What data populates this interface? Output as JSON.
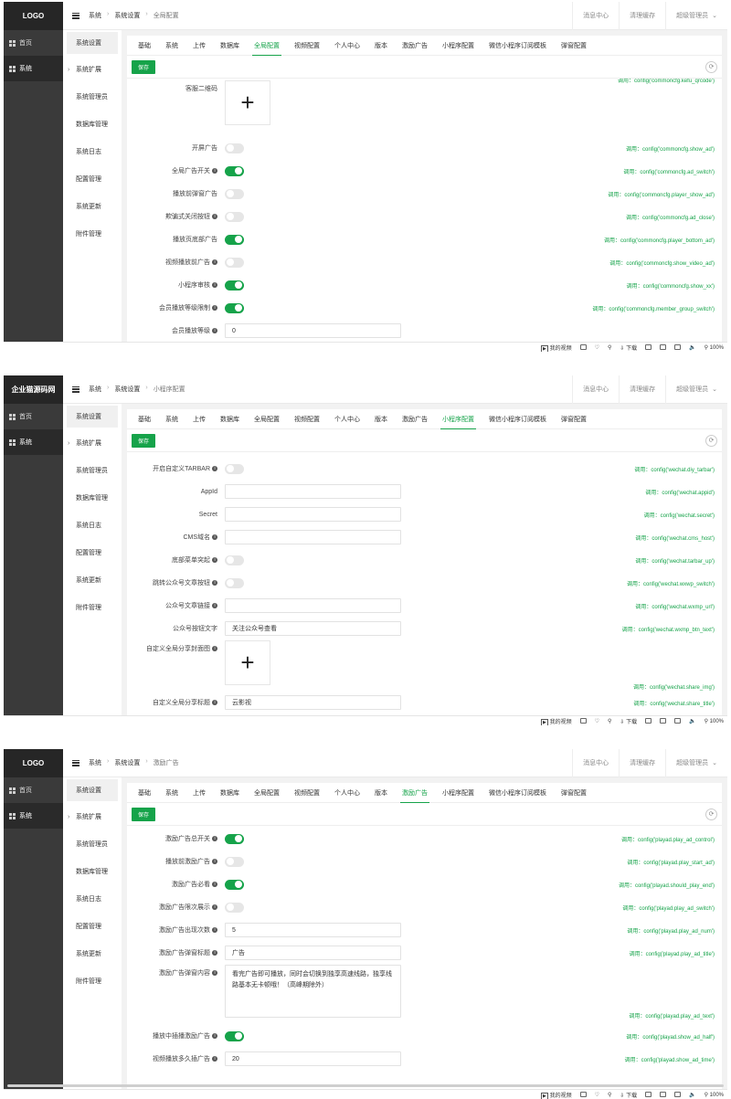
{
  "common": {
    "logo_a": "LOGO",
    "logo_b": "企业猫源码网",
    "menu_home": "首页",
    "menu_system": "系统",
    "crumb_1": "系统",
    "crumb_2": "系统设置",
    "top_msg": "消息中心",
    "top_cache": "清理缓存",
    "top_user": "超级管理员",
    "save": "保存",
    "call_prefix": "调用：",
    "sub_menu": [
      "系统设置",
      "系统扩展",
      "系统管理员",
      "数据库管理",
      "系统日志",
      "配置管理",
      "系统更新",
      "附件管理"
    ],
    "tabs": [
      "基础",
      "系统",
      "上传",
      "数据库",
      "全局配置",
      "视频配置",
      "个人中心",
      "版本",
      "激励广告",
      "小程序配置",
      "微信小程序订阅模板",
      "弹窗配置"
    ],
    "status": {
      "video": "我的视频",
      "download": "下载",
      "zoom": "100%"
    }
  },
  "shots": [
    {
      "logo": "LOGO",
      "crumb_current": "全局配置",
      "active_tab": 4,
      "rows": [
        {
          "label": "客服二维码",
          "type": "upload",
          "hint": "config('commoncfg.kefu_qrcode')"
        },
        {
          "label": "开屏广告",
          "type": "toggle",
          "on": false,
          "hint": "config('commoncfg.show_ad')"
        },
        {
          "label": "全局广告开关",
          "type": "toggle",
          "on": true,
          "tip": true,
          "hint": "config('commoncfg.ad_switch')"
        },
        {
          "label": "播放前弹窗广告",
          "type": "toggle",
          "on": false,
          "hint": "config('commoncfg.player_show_ad')"
        },
        {
          "label": "欺骗式关闭按钮",
          "type": "toggle",
          "on": false,
          "tip": true,
          "hint": "config('commoncfg.ad_close')"
        },
        {
          "label": "播放页底部广告",
          "type": "toggle",
          "on": true,
          "hint": "config('commoncfg.player_bottom_ad')"
        },
        {
          "label": "视频播放前广告",
          "type": "toggle",
          "on": false,
          "tip": true,
          "hint": "config('commoncfg.show_video_ad')"
        },
        {
          "label": "小程序审核",
          "type": "toggle",
          "on": true,
          "tip": true,
          "hint": "config('commoncfg.show_xx')"
        },
        {
          "label": "会员播放等级限制",
          "type": "toggle",
          "on": true,
          "tip": true,
          "hint": "config('commoncfg.member_group_switch')"
        },
        {
          "label": "会员播放等级",
          "type": "input",
          "value": "0",
          "tip": true,
          "hint": ""
        }
      ]
    },
    {
      "logo": "企业猫源码网",
      "crumb_current": "小程序配置",
      "active_tab": 9,
      "rows": [
        {
          "label": "开启自定义TARBAR",
          "type": "toggle",
          "on": false,
          "tip": true,
          "hint": "config('wechat.diy_tarbar')"
        },
        {
          "label": "AppId",
          "type": "input",
          "value": "",
          "hint": "config('wechat.appid')"
        },
        {
          "label": "Secret",
          "type": "input",
          "value": "",
          "hint": "config('wechat.secret')"
        },
        {
          "label": "CMS域名",
          "type": "input",
          "value": "",
          "tip": true,
          "hint": "config('wechat.cms_host')"
        },
        {
          "label": "底部菜单突起",
          "type": "toggle",
          "on": false,
          "tip": true,
          "hint": "config('wechat.tarbar_up')"
        },
        {
          "label": "跳转公众号文章按钮",
          "type": "toggle",
          "on": false,
          "tip": true,
          "hint": "config('wechat.wxwp_switch')"
        },
        {
          "label": "公众号文章链接",
          "type": "input",
          "value": "",
          "tip": true,
          "hint": "config('wechat.wxmp_url')"
        },
        {
          "label": "公众号按钮文字",
          "type": "input",
          "value": "关注公众号查看",
          "hint": "config('wechat.wxmp_btn_text')"
        },
        {
          "label": "自定义全局分享封面图",
          "type": "upload",
          "tip": true,
          "hint": "config('wechat.share_img')"
        },
        {
          "label": "自定义全局分享标题",
          "type": "input",
          "value": "云影视",
          "tip": true,
          "hint": "config('wechat.share_title')"
        }
      ]
    },
    {
      "logo": "LOGO",
      "crumb_current": "激励广告",
      "active_tab": 8,
      "rows": [
        {
          "label": "激励广告总开关",
          "type": "toggle",
          "on": true,
          "tip": true,
          "hint": "config('playad.play_ad_control')"
        },
        {
          "label": "播放前激励广告",
          "type": "toggle",
          "on": false,
          "tip": true,
          "hint": "config('playad.play_start_ad')"
        },
        {
          "label": "激励广告必看",
          "type": "toggle",
          "on": true,
          "tip": true,
          "hint": "config('playad.should_play_end')"
        },
        {
          "label": "激励广告限次展示",
          "type": "toggle",
          "on": false,
          "tip": true,
          "hint": "config('playad.play_ad_switch')"
        },
        {
          "label": "激励广告出现次数",
          "type": "input",
          "value": "5",
          "tip": true,
          "hint": "config('playad.play_ad_num')"
        },
        {
          "label": "激励广告弹窗标题",
          "type": "input",
          "value": "广告",
          "tip": true,
          "hint": "config('playad.play_ad_title')"
        },
        {
          "label": "激励广告弹窗内容",
          "type": "textarea",
          "value": "看完广告即可播放，同时会切换到独享高速线路，独享线路基本无卡顿哦！（高峰期除外）",
          "tip": true,
          "hint": "config('playad.play_ad_text')"
        },
        {
          "label": "播放中插播激励广告",
          "type": "toggle",
          "on": true,
          "tip": true,
          "hint": "config('playad.show_ad_half')"
        },
        {
          "label": "视频播放多久插广告",
          "type": "input",
          "value": "20",
          "tip": true,
          "hint": "config('playad.show_ad_time')"
        }
      ]
    }
  ]
}
